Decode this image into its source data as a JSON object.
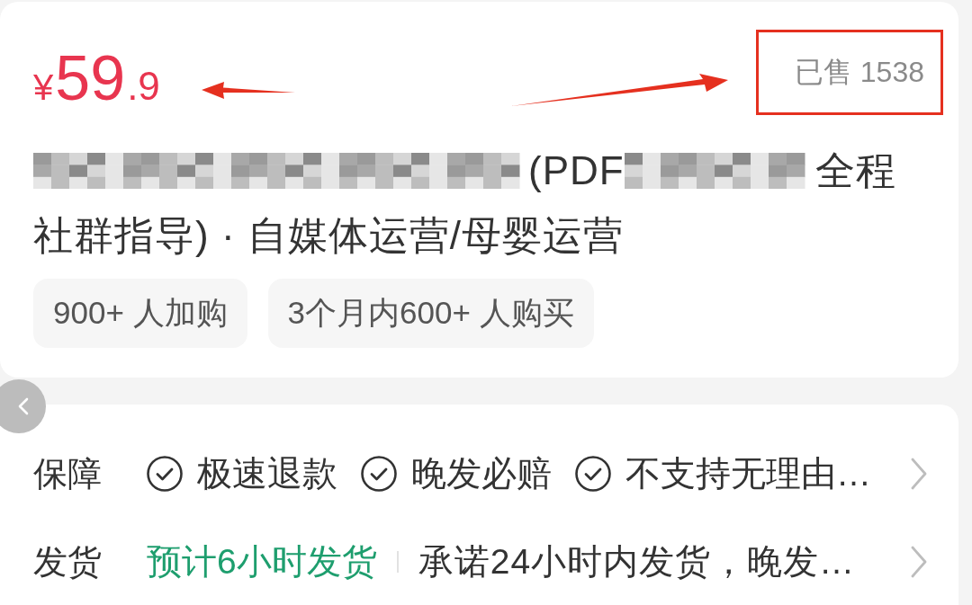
{
  "price": {
    "currency": "¥",
    "whole": "59",
    "fraction": ".9"
  },
  "sold": {
    "text": "已售 1538",
    "highlighted": true
  },
  "title": {
    "lines": [
      {
        "parts": [
          {
            "kind": "mosaic"
          },
          {
            "kind": "text",
            "text": "(PDF"
          },
          {
            "kind": "mosaic"
          },
          {
            "kind": "text",
            "text": "全程"
          }
        ]
      },
      {
        "parts": [
          {
            "kind": "text",
            "text": "社群指导) · 自媒体运营/母婴运营"
          }
        ]
      }
    ]
  },
  "tags": [
    "900+ 人加购",
    "3个月内600+ 人购买"
  ],
  "rows": [
    {
      "kind": "guarantees",
      "label": "保障",
      "items": [
        "极速退款",
        "晚发必赔",
        "不支持无理由…"
      ]
    },
    {
      "kind": "shipping",
      "label": "发货",
      "highlight": "预计6小时发货",
      "detail": "承诺24小时内发货，晚发…"
    }
  ]
}
